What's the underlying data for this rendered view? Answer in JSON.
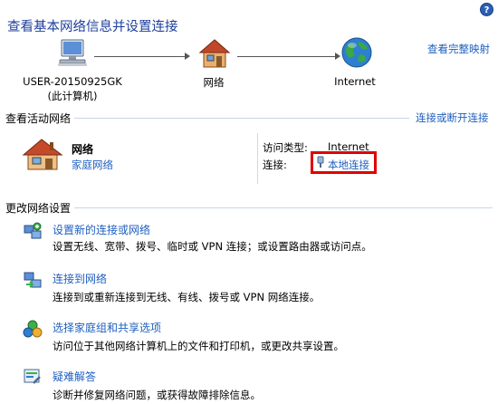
{
  "header": {
    "title": "查看基本网络信息并设置连接",
    "full_map_link": "查看完整映射",
    "help_glyph": "?"
  },
  "network_map": {
    "computer_name": "USER-20150925GK",
    "computer_sub": "(此计算机)",
    "network_label": "网络",
    "internet_label": "Internet"
  },
  "active_networks": {
    "heading": "查看活动网络",
    "connect_disconnect_link": "连接或断开连接",
    "network_name": "网络",
    "network_type": "家庭网络",
    "access_type_label": "访问类型:",
    "access_type_value": "Internet",
    "connection_label": "连接:",
    "connection_value": "本地连接"
  },
  "change_settings": {
    "heading": "更改网络设置",
    "tasks": [
      {
        "title": "设置新的连接或网络",
        "desc": "设置无线、宽带、拨号、临时或 VPN 连接；或设置路由器或访问点。",
        "icon": "new-connection-icon"
      },
      {
        "title": "连接到网络",
        "desc": "连接到或重新连接到无线、有线、拨号或 VPN 网络连接。",
        "icon": "connect-network-icon"
      },
      {
        "title": "选择家庭组和共享选项",
        "desc": "访问位于其他网络计算机上的文件和打印机，或更改共享设置。",
        "icon": "homegroup-icon"
      },
      {
        "title": "疑难解答",
        "desc": "诊断并修复网络问题，或获得故障排除信息。",
        "icon": "troubleshoot-icon"
      }
    ]
  },
  "colors": {
    "link": "#1f5fbf",
    "title": "#1e3f9b",
    "highlight": "#e00000"
  }
}
